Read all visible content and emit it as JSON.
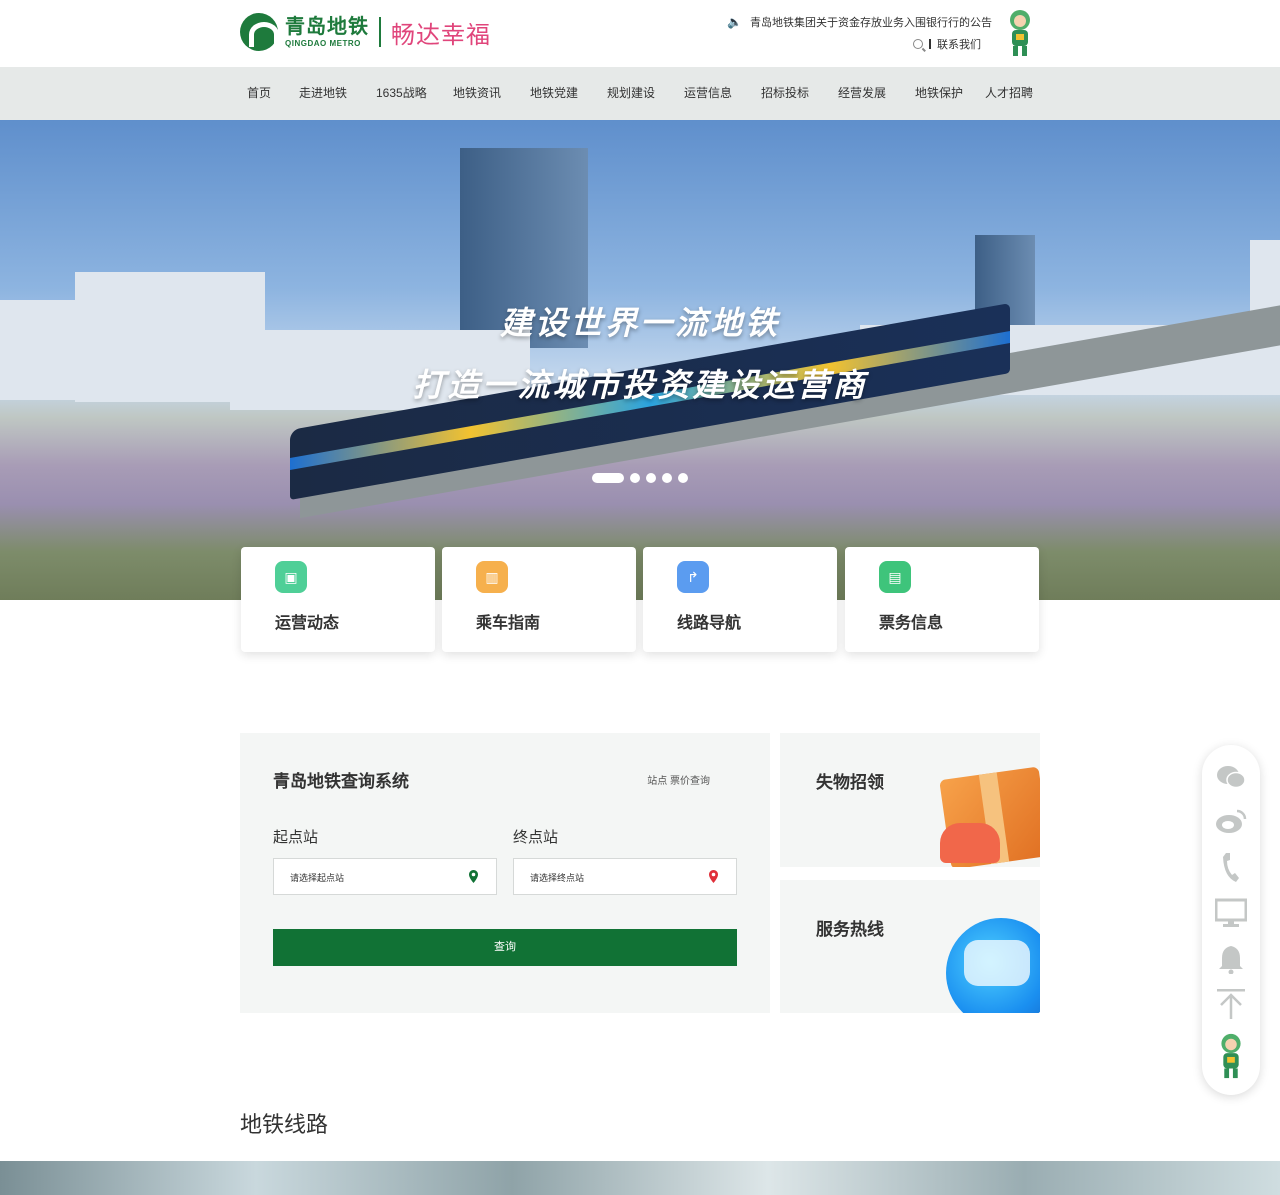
{
  "header": {
    "logo_cn": "青岛地铁",
    "logo_en": "QINGDAO  METRO",
    "slogan": "畅达幸福",
    "notice": "青岛地铁集团关于资金存放业务入围银行行的公告",
    "contact": "联系我们"
  },
  "nav": {
    "items": [
      "首页",
      "走进地铁",
      "1635战略",
      "地铁资讯",
      "地铁党建",
      "规划建设",
      "运营信息",
      "招标投标",
      "经营发展",
      "地铁保护",
      "人才招聘"
    ]
  },
  "banner": {
    "line1": "建设世界一流地铁",
    "line2": "打造一流城市投资建设运营商",
    "slides": 5,
    "active_slide": 1
  },
  "quick_links": [
    {
      "label": "运营动态",
      "icon": "train-icon",
      "color": "#4fcf97"
    },
    {
      "label": "乘车指南",
      "icon": "map-icon",
      "color": "#f6b04d"
    },
    {
      "label": "线路导航",
      "icon": "route-icon",
      "color": "#5b9cf0"
    },
    {
      "label": "票务信息",
      "icon": "ticket-icon",
      "color": "#3ec47b"
    }
  ],
  "query": {
    "title": "青岛地铁查询系统",
    "link": "站点 票价查询",
    "start_label": "起点站",
    "start_placeholder": "请选择起点站",
    "end_label": "终点站",
    "end_placeholder": "请选择终点站",
    "button": "查询"
  },
  "lost_found": {
    "title": "失物招领"
  },
  "hotline": {
    "title": "服务热线"
  },
  "section": {
    "title": "地铁线路"
  },
  "colors": {
    "brand": "#117235",
    "nav_bg": "#e6e9e8",
    "panel_bg": "#f4f6f5"
  }
}
